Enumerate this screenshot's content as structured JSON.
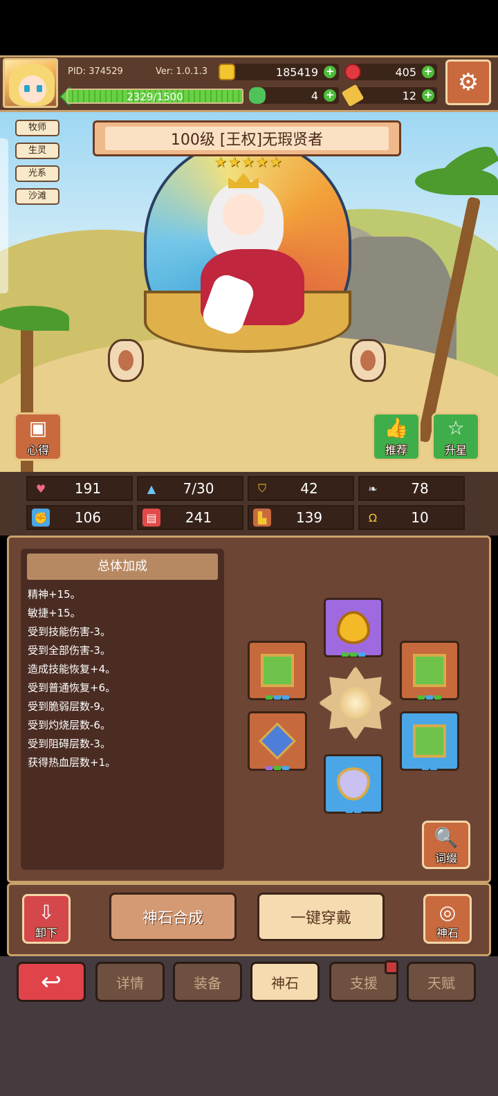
{
  "header": {
    "pid": "PID: 374529",
    "version": "Ver: 1.0.1.3",
    "gold": "185419",
    "ruby": "405",
    "clover": "4",
    "keys": "12",
    "exp_text": "2329/1500",
    "exp_progress": 1.0,
    "settings_icon": "gear-icon"
  },
  "hero": {
    "tags": [
      "牧师",
      "生灵",
      "光系",
      "沙滩"
    ],
    "title": "100级 [王权]无瑕贤者",
    "stars": 5
  },
  "scene_buttons": {
    "insight": "心得",
    "recommend": "推荐",
    "star_up": "升星"
  },
  "stats": [
    {
      "icon": "heart-icon",
      "color": "#f06a8a",
      "value": "191"
    },
    {
      "icon": "water-drop-icon",
      "color": "#6fc3f0",
      "value": "7/30"
    },
    {
      "icon": "shield-icon",
      "color": "#f2c531",
      "value": "42"
    },
    {
      "icon": "wing-icon",
      "color": "#dfe6ef",
      "value": "78"
    },
    {
      "icon": "fist-icon",
      "color": "#f3a889",
      "value": "106"
    },
    {
      "icon": "book-icon",
      "color": "#e24a4a",
      "value": "241"
    },
    {
      "icon": "boot-icon",
      "color": "#f2c531",
      "value": "139"
    },
    {
      "icon": "horseshoe-icon",
      "color": "#f2c531",
      "value": "10"
    }
  ],
  "bonus": {
    "title": "总体加成",
    "lines": [
      "精神+15。",
      "敏捷+15。",
      "受到技能伤害-3。",
      "受到全部伤害-3。",
      "造成技能恢复+4。",
      "受到普通恢复+6。",
      "受到脆弱层数-9。",
      "受到灼烧层数-6。",
      "受到阻碍层数-3。",
      "获得热血层数+1。"
    ]
  },
  "affix_button": "词缀",
  "actions": {
    "unequip": "卸下",
    "synthesize": "神石合成",
    "one_click_equip": "一键穿戴",
    "godstone": "神石"
  },
  "tabs": {
    "back": "↩",
    "details": "详情",
    "equipment": "装备",
    "godstone": "神石",
    "support": "支援",
    "talent": "天赋"
  }
}
